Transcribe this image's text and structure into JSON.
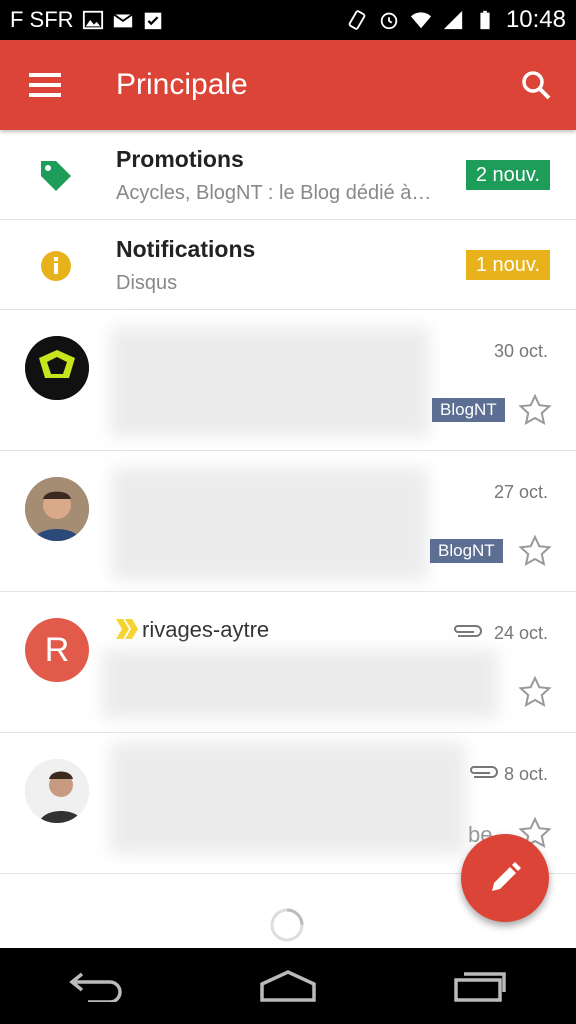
{
  "status_bar": {
    "carrier": "F SFR",
    "time": "10:48",
    "icons": [
      "image-icon",
      "mail-icon",
      "clipboard-check-icon",
      "vibrate-icon",
      "alarm-icon",
      "wifi-icon",
      "signal-icon",
      "battery-icon"
    ]
  },
  "app_bar": {
    "title": "Principale",
    "menu_icon": "menu-icon",
    "search_icon": "search-icon",
    "color": "#db4437"
  },
  "categories": [
    {
      "title": "Promotions",
      "subtitle": "Acycles, BlogNT : le Blog dédié à la…",
      "badge": "2 nouv.",
      "badge_color": "#1e9c5a",
      "icon": "tag-icon",
      "icon_color": "#1e9c5a"
    },
    {
      "title": "Notifications",
      "subtitle": "Disqus",
      "badge": "1 nouv.",
      "badge_color": "#e8b21c",
      "icon": "info-icon",
      "icon_color": "#e8b21c"
    }
  ],
  "emails": [
    {
      "date": "30 oct.",
      "label": "BlogNT",
      "avatar": "logo-avatar"
    },
    {
      "date": "27 oct.",
      "label": "BlogNT",
      "avatar": "photo-avatar"
    },
    {
      "sender": "rivages-aytre",
      "date": "24 oct.",
      "avatar_letter": "R",
      "avatar_color": "#e25a4a",
      "attachment": true,
      "importance": "importance-marker-icon"
    },
    {
      "date": "8 oct.",
      "avatar": "photo-avatar",
      "attachment": true,
      "trailing_text": "be"
    }
  ],
  "fab": {
    "icon": "pencil-icon",
    "color": "#db4437"
  },
  "nav": [
    "back-icon",
    "home-icon",
    "recents-icon"
  ]
}
